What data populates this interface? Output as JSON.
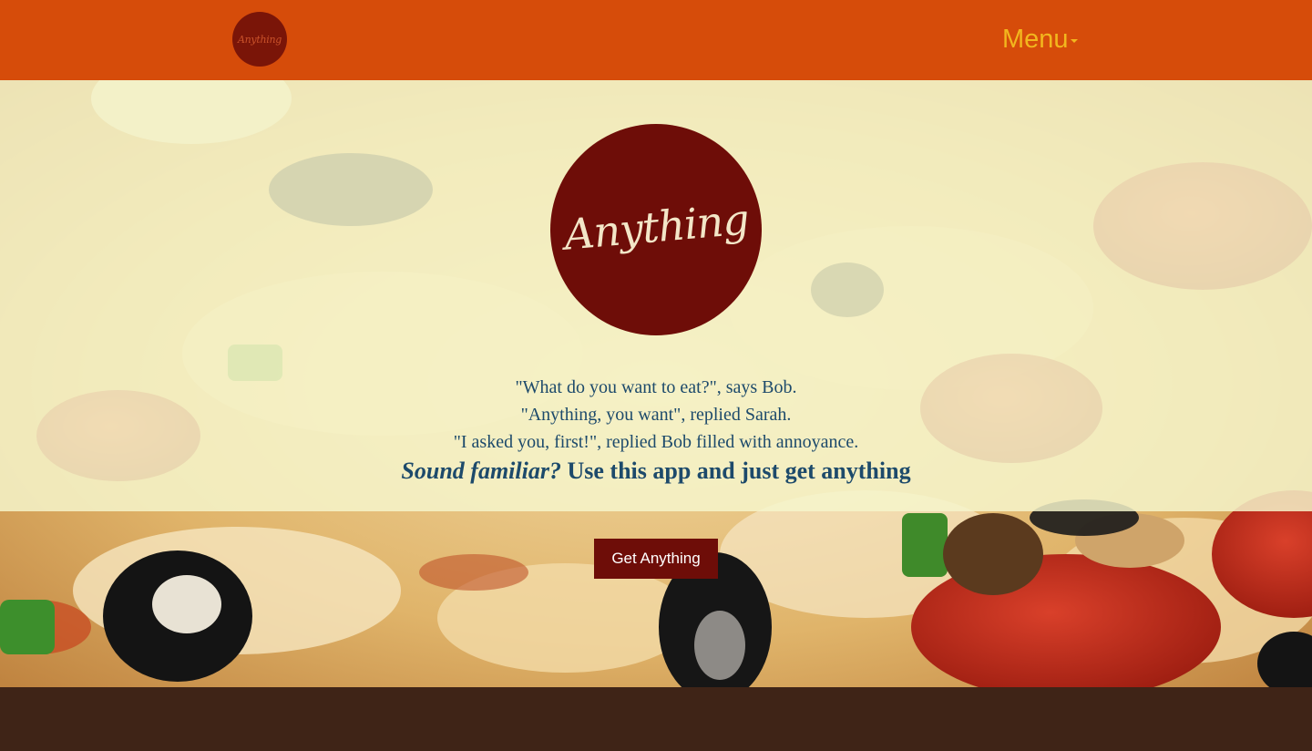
{
  "navbar": {
    "logo_text": "Anything",
    "menu_label": "Menu",
    "background_color": "#d64c0a",
    "menu_color": "#f2b71e"
  },
  "hero": {
    "logo_text": "Anything",
    "story_lines": [
      "\"What do you want to eat?\", says Bob.",
      "\"Anything, you want\", replied Sarah.",
      "\"I asked you, first!\", replied Bob filled with annoyance."
    ],
    "tagline_emphasis": "Sound familiar?",
    "tagline_rest": " Use this app and just get anything",
    "cta_label": "Get Anything",
    "logo_color": "#6e0d08",
    "text_color": "#1d4a6b"
  },
  "footer": {
    "background_color": "#3f2417"
  }
}
